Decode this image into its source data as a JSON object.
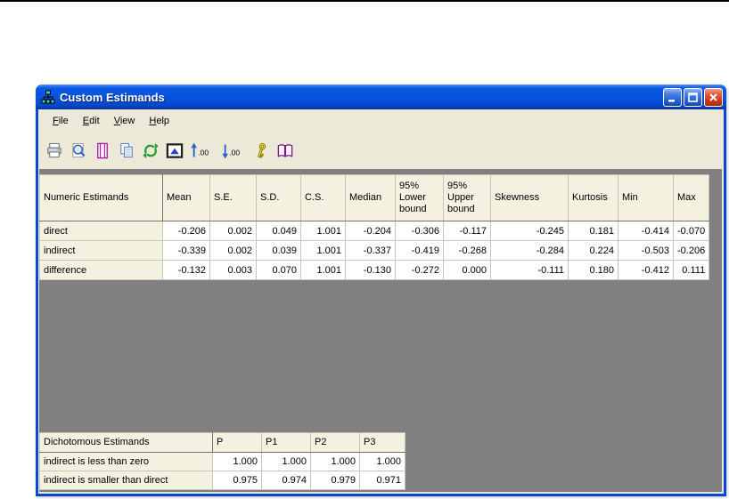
{
  "window": {
    "title": "Custom Estimands",
    "controls": {
      "minimize": "minimize",
      "maximize": "maximize",
      "close": "close"
    }
  },
  "menu": {
    "items": [
      {
        "label": "File"
      },
      {
        "label": "Edit"
      },
      {
        "label": "View"
      },
      {
        "label": "Help"
      }
    ]
  },
  "toolbar": {
    "icons": [
      "print-icon",
      "print-preview-icon",
      "page-setup-icon",
      "copy-icon",
      "refresh-icon",
      "picture-icon",
      "increase-decimal-icon",
      "decrease-decimal-icon",
      "key-icon",
      "book-icon"
    ],
    "decimal_label": ".00"
  },
  "numeric_table": {
    "columns": [
      "Numeric Estimands",
      "Mean",
      "S.E.",
      "S.D.",
      "C.S.",
      "Median",
      "95%\nLower\nbound",
      "95%\nUpper\nbound",
      "Skewness",
      "Kurtosis",
      "Min",
      "Max"
    ],
    "rows": [
      {
        "label": "direct",
        "values": [
          "-0.206",
          "0.002",
          "0.049",
          "1.001",
          "-0.204",
          "-0.306",
          "-0.117",
          "-0.245",
          "0.181",
          "-0.414",
          "-0.070"
        ]
      },
      {
        "label": "indirect",
        "values": [
          "-0.339",
          "0.002",
          "0.039",
          "1.001",
          "-0.337",
          "-0.419",
          "-0.268",
          "-0.284",
          "0.224",
          "-0.503",
          "-0.206"
        ]
      },
      {
        "label": "difference",
        "values": [
          "-0.132",
          "0.003",
          "0.070",
          "1.001",
          "-0.130",
          "-0.272",
          "0.000",
          "-0.111",
          "0.180",
          "-0.412",
          "0.111"
        ]
      }
    ]
  },
  "dichotomous_table": {
    "columns": [
      "Dichotomous Estimands",
      "P",
      "P1",
      "P2",
      "P3"
    ],
    "rows": [
      {
        "label": "indirect is less than zero",
        "values": [
          "1.000",
          "1.000",
          "1.000",
          "1.000"
        ]
      },
      {
        "label": "indirect is smaller than direct",
        "values": [
          "0.975",
          "0.974",
          "0.979",
          "0.971"
        ]
      }
    ]
  },
  "colors": {
    "titlebar_blue": "#0852DC",
    "window_border": "#0846D8",
    "chrome_face": "#ECE9D8",
    "client_gray": "#808080",
    "table_header_bg": "#F4F1E1",
    "grid_line": "#C6C6B8",
    "close_red": "#CC3A18"
  }
}
